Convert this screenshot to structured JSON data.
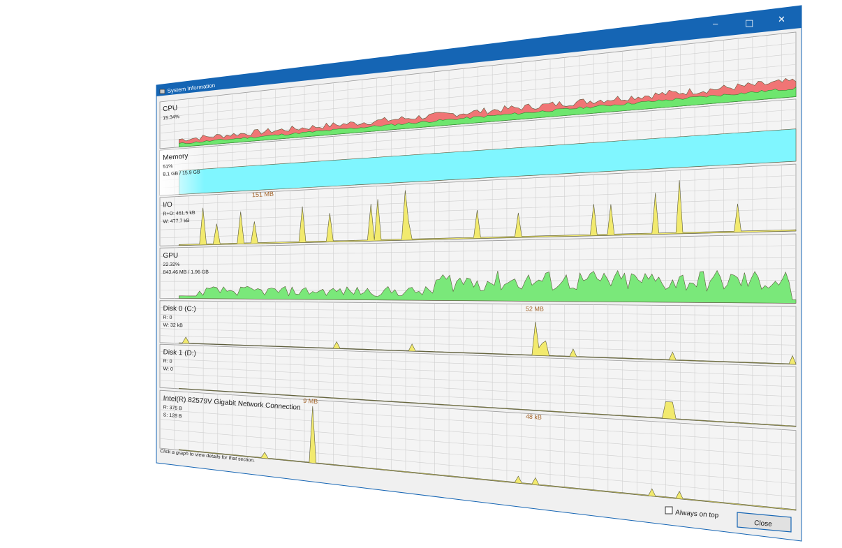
{
  "window": {
    "title": "System Information",
    "minimize_glyph": "–",
    "maximize_glyph": "□",
    "close_glyph": "✕"
  },
  "sections": [
    {
      "id": "cpu",
      "name": "CPU",
      "lines": [
        "15.34%"
      ]
    },
    {
      "id": "memory",
      "name": "Memory",
      "lines": [
        "51%",
        "8.1 GB / 15.9 GB"
      ]
    },
    {
      "id": "io",
      "name": "I/O",
      "lines": [
        "R+O: 461.5 kB",
        "W: 477.7 kB"
      ]
    },
    {
      "id": "gpu",
      "name": "GPU",
      "lines": [
        "22.32%",
        "843.46 MB / 1.96 GB"
      ]
    },
    {
      "id": "disk0",
      "name": "Disk 0 (C:)",
      "lines": [
        "R: 0",
        "W: 32 kB"
      ]
    },
    {
      "id": "disk1",
      "name": "Disk 1 (D:)",
      "lines": [
        "R: 0",
        "W: 0"
      ]
    },
    {
      "id": "network",
      "name": "Intel(R) 82579V Gigabit Network Connection",
      "lines": [
        "R: 375 B",
        "S: 128 B"
      ]
    }
  ],
  "annotations": {
    "io_peak": "151 MB",
    "disk0_peak": "52 MB",
    "net_peak1": "9 MB",
    "net_peak2": "48 kB"
  },
  "footer": {
    "hint": "Click a graph to view details for that section.",
    "always_on_top_label": "Always on top",
    "always_on_top_checked": false,
    "close_button": "Close"
  },
  "colors": {
    "titlebar": "#1565b4",
    "cpu_total": "#f07575",
    "cpu_kernel": "#6ee66e",
    "memory": "#80f6ff",
    "io": "#f2ea6e",
    "gpu": "#7ae87a",
    "grid": "#cfcfcf",
    "panel_bg": "#f4f4f4"
  }
}
